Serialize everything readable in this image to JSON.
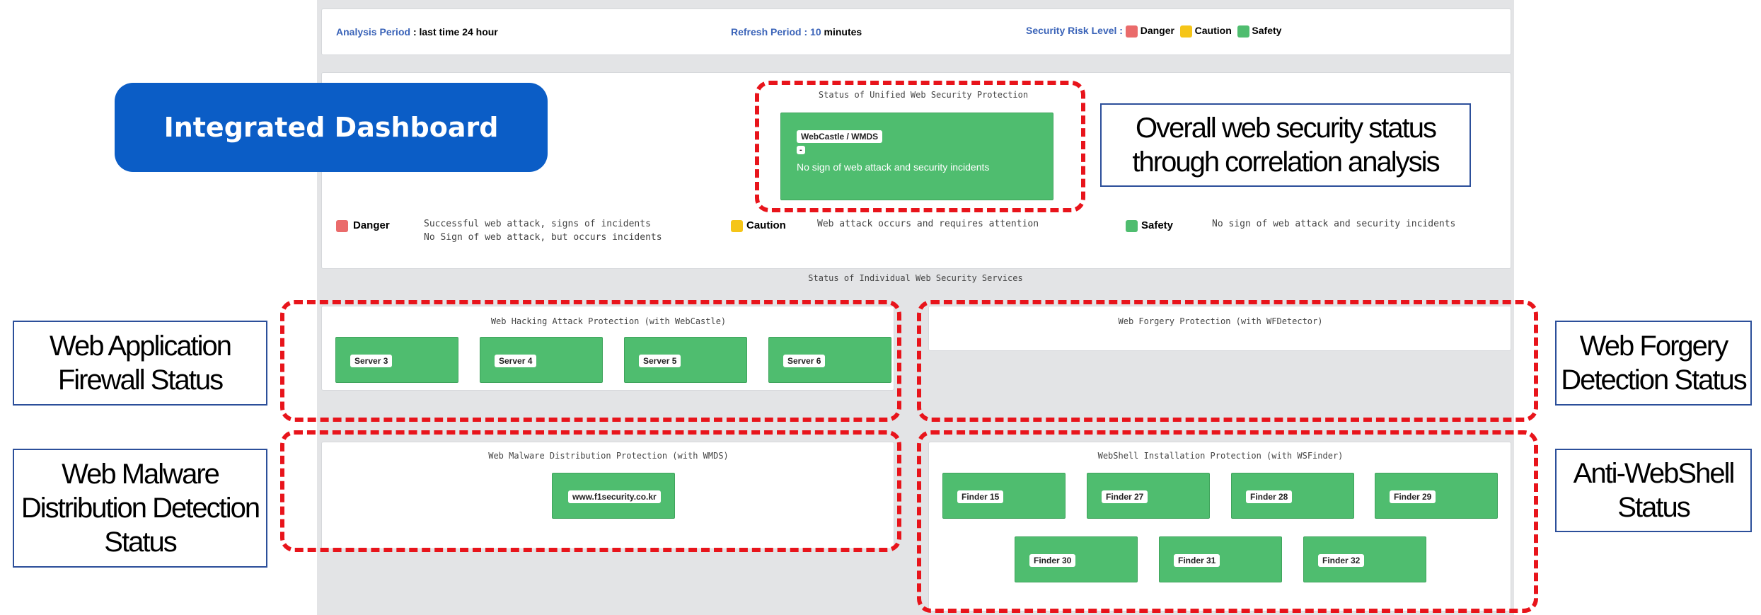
{
  "header": {
    "analysis_label": "Analysis Period",
    "analysis_value": "last time 24 hour",
    "refresh_label": "Refresh Period :",
    "refresh_number": "10",
    "refresh_unit": "minutes",
    "risk_label": "Security Risk Level :",
    "levels": [
      {
        "name": "Danger",
        "color": "#ea6b6b"
      },
      {
        "name": "Caution",
        "color": "#f5c518"
      },
      {
        "name": "Safety",
        "color": "#4fbd6f"
      }
    ]
  },
  "title_banner": "Integrated Dashboard",
  "unified": {
    "title": "Status of Unified Web Security Protection",
    "tag": "WebCastle / WMDS",
    "small_tag": "-",
    "message": "No sign of web attack and security incidents"
  },
  "legend": {
    "danger_title": "Danger",
    "danger_line1": "Successful web attack, signs of incidents",
    "danger_line2": "No Sign of web attack, but occurs incidents",
    "caution_title": "Caution",
    "caution_desc": "Web attack occurs and requires attention",
    "safety_title": "Safety",
    "safety_desc": "No sign of web attack and security incidents"
  },
  "individual_title": "Status of Individual Web Security Services",
  "hacking": {
    "title": "Web Hacking Attack Protection (with WebCastle)",
    "servers": [
      "Server 3",
      "Server 4",
      "Server 5",
      "Server 6"
    ]
  },
  "forgery": {
    "title": "Web Forgery Protection (with WFDetector)"
  },
  "malware": {
    "title": "Web Malware Distribution Protection (with WMDS)",
    "site": "www.f1security.co.kr"
  },
  "webshell": {
    "title": "WebShell Installation Protection (with WSFinder)",
    "finders": [
      "Finder 15",
      "Finder 27",
      "Finder 28",
      "Finder 29",
      "Finder 30",
      "Finder 31",
      "Finder 32"
    ]
  },
  "callouts": {
    "overall_line1": "Overall web security status",
    "overall_line2": "through correlation analysis",
    "waf_line1": "Web Application",
    "waf_line2": "Firewall Status",
    "forgery_line1": "Web Forgery",
    "forgery_line2": "Detection Status",
    "malware_line1": "Web Malware",
    "malware_line2": "Distribution Detection",
    "malware_line3": "Status",
    "webshell_line1": "Anti-WebShell",
    "webshell_line2": "Status"
  }
}
